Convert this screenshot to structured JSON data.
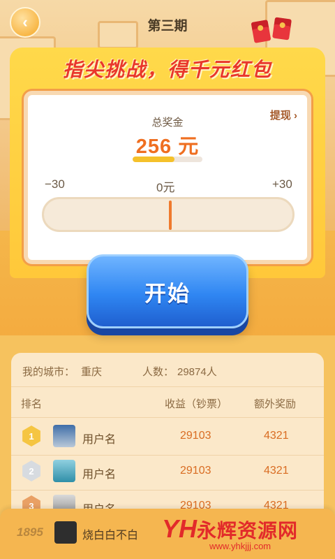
{
  "header": {
    "title": "第三期"
  },
  "banner": {
    "text": "指尖挑战，得千元红包"
  },
  "prize": {
    "label": "总奖金",
    "value": "256 元",
    "withdraw": "提现 ›",
    "progress_fraction": 0.6
  },
  "scale": {
    "min": "−30",
    "mid": "0元",
    "max": "+30"
  },
  "start_button": {
    "label": "开始"
  },
  "leaderboard": {
    "city_label": "我的城市：",
    "city": "重庆",
    "count_label": "人数：",
    "count": "29874人",
    "columns": [
      "排名",
      "收益（钞票）",
      "额外奖励"
    ],
    "rows": [
      {
        "rank": "1",
        "name": "用户名",
        "earnings": "29103",
        "bonus": "4321",
        "medal_color": "#f5c542"
      },
      {
        "rank": "2",
        "name": "用户名",
        "earnings": "29103",
        "bonus": "4321",
        "medal_color": "#d7dbe0"
      },
      {
        "rank": "3",
        "name": "用户名",
        "earnings": "29103",
        "bonus": "4321",
        "medal_color": "#e9a064"
      }
    ]
  },
  "my_entry": {
    "rank": "1895",
    "name": "烧白白不白"
  },
  "watermark": {
    "text": "永辉资源网",
    "url": "www.yhkjjj.com"
  },
  "colors": {
    "accent": "#ef6f21",
    "button_blue": "#2f86f2",
    "banner_red": "#e9372b"
  }
}
